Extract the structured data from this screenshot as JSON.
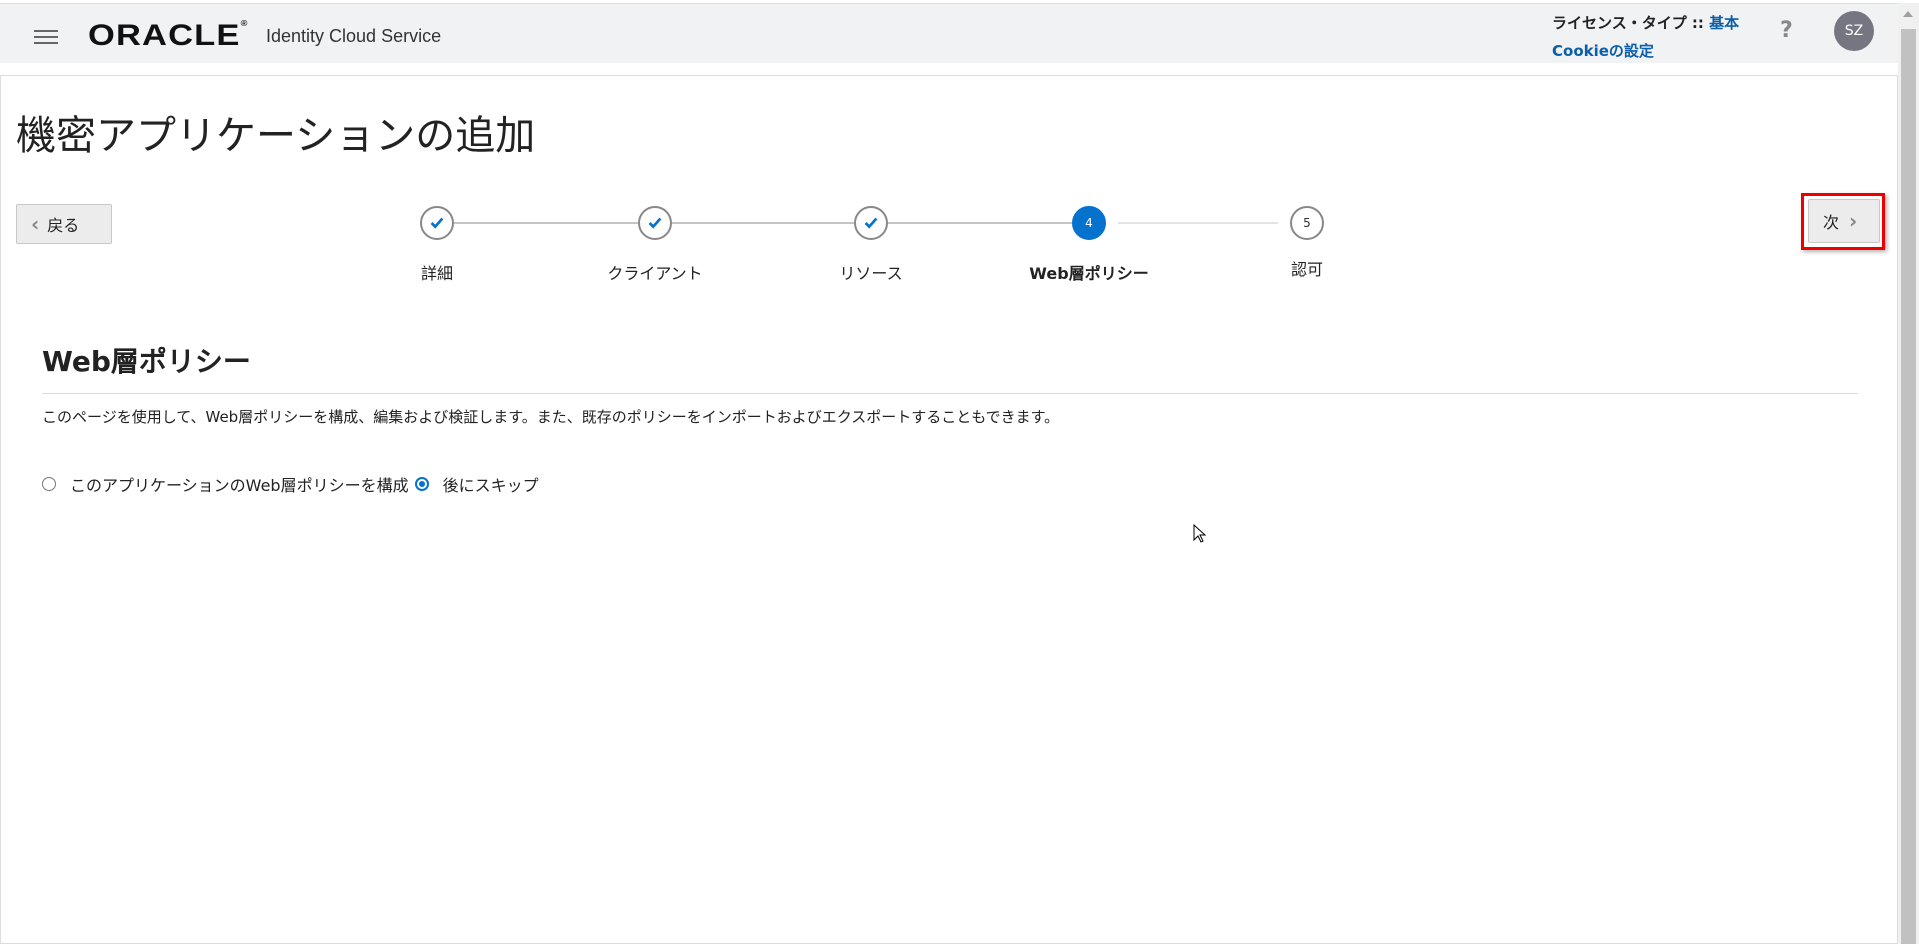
{
  "header": {
    "logo": "ORACLE",
    "product": "Identity Cloud Service",
    "license_label": "ライセンス・タイプ ::",
    "license_value": "基本",
    "cookie_link": "Cookieの設定",
    "help": "?",
    "avatar": "SZ"
  },
  "page": {
    "title": "機密アプリケーションの追加",
    "back_label": "戻る",
    "next_label": "次"
  },
  "steps": [
    {
      "label": "詳細",
      "status": "complete"
    },
    {
      "label": "クライアント",
      "status": "complete"
    },
    {
      "label": "リソース",
      "status": "complete"
    },
    {
      "label": "Web層ポリシー",
      "number": "4",
      "status": "active"
    },
    {
      "label": "認可",
      "number": "5",
      "status": "pending"
    }
  ],
  "section": {
    "title": "Web層ポリシー",
    "description": "このページを使用して、Web層ポリシーを構成、編集および検証します。また、既存のポリシーをインポートおよびエクスポートすることもできます。",
    "options": [
      {
        "label": "このアプリケーションのWeb層ポリシーを構成",
        "checked": false
      },
      {
        "label": "後にスキップ",
        "checked": true
      }
    ]
  },
  "colors": {
    "accent": "#0572ce",
    "link": "#0b5ea8",
    "highlight": "#ee0000"
  }
}
